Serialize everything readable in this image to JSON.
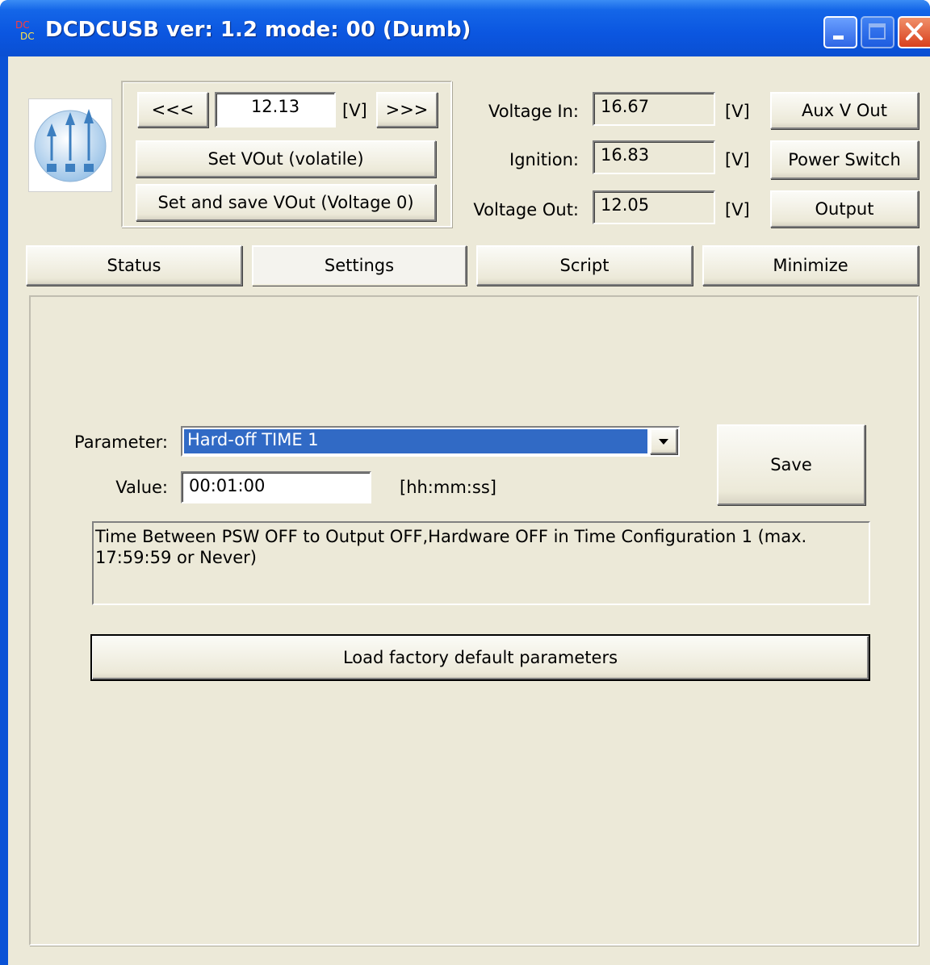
{
  "window": {
    "title": "DCDCUSB ver: 1.2 mode: 00 (Dumb)",
    "icon": "dcdc-app-icon",
    "controls": [
      "minimize-icon",
      "maximize-icon",
      "close-icon"
    ]
  },
  "vout": {
    "decrease_label": "<<<",
    "value": "12.13",
    "unit": "[V]",
    "increase_label": ">>>",
    "set_volatile_label": "Set VOut (volatile)",
    "set_save_label": "Set and save VOut (Voltage 0)"
  },
  "readings": [
    {
      "label": "Voltage In:",
      "value": "16.67",
      "unit": "[V]",
      "button": "Aux V Out"
    },
    {
      "label": "Ignition:",
      "value": "16.83",
      "unit": "[V]",
      "button": "Power Switch"
    },
    {
      "label": "Voltage Out:",
      "value": "12.05",
      "unit": "[V]",
      "button": "Output"
    }
  ],
  "tabs": [
    {
      "label": "Status"
    },
    {
      "label": "Settings",
      "active": true
    },
    {
      "label": "Script"
    },
    {
      "label": "Minimize"
    }
  ],
  "settings": {
    "parameter_label": "Parameter:",
    "parameter_value": "Hard-off TIME 1",
    "value_label": "Value:",
    "value": "00:01:00",
    "value_unit": "[hh:mm:ss]",
    "save_label": "Save",
    "description": "Time Between PSW OFF to Output OFF,Hardware OFF in Time Configuration 1 (max. 17:59:59 or Never)",
    "load_defaults_label": "Load factory default parameters"
  },
  "colors": {
    "titlebar": "#0a52d6",
    "window_bg": "#ece9d8",
    "selection": "#316ac5",
    "close_button": "#d8401c"
  }
}
